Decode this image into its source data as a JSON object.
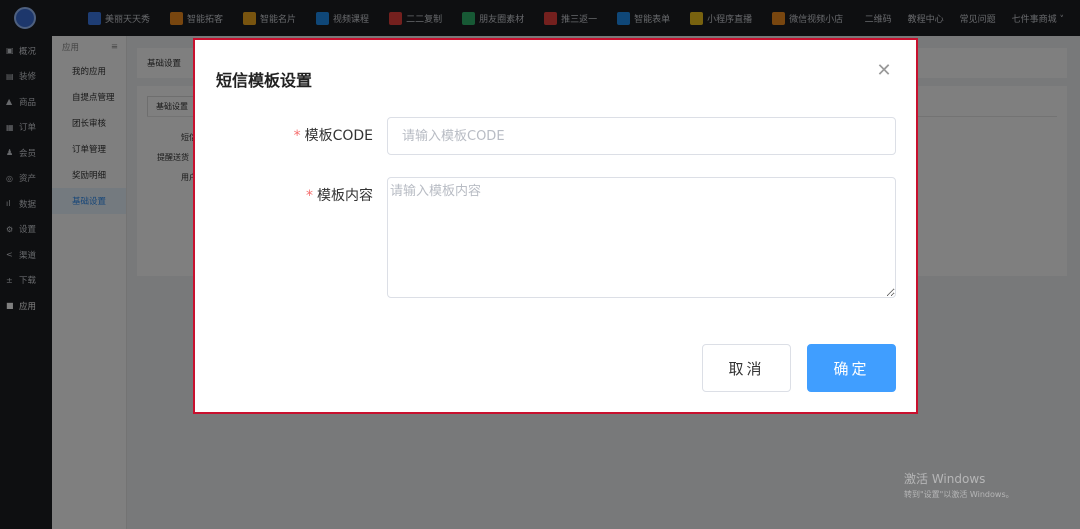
{
  "topbar": {
    "apps": [
      {
        "label": "美丽天天秀",
        "color": "#3c7be8"
      },
      {
        "label": "智能拓客",
        "color": "#f08c1f"
      },
      {
        "label": "智能名片",
        "color": "#f0a91f"
      },
      {
        "label": "视频课程",
        "color": "#1f8ff0"
      },
      {
        "label": "二二复制",
        "color": "#e8413c"
      },
      {
        "label": "朋友圈素材",
        "color": "#2fb36b"
      },
      {
        "label": "推三返一",
        "color": "#e8413c"
      },
      {
        "label": "智能表单",
        "color": "#1f8ff0"
      },
      {
        "label": "小程序直播",
        "color": "#f0c41f"
      },
      {
        "label": "微信视频小店",
        "color": "#f08c1f"
      }
    ],
    "right_links": [
      "二维码",
      "教程中心",
      "常见问题",
      "七件事商城 ˅"
    ]
  },
  "sidebar": {
    "items": [
      {
        "icon": "▣",
        "label": "概况"
      },
      {
        "icon": "▤",
        "label": "装修"
      },
      {
        "icon": "▲",
        "label": "商品"
      },
      {
        "icon": "▦",
        "label": "订单"
      },
      {
        "icon": "♟",
        "label": "会员"
      },
      {
        "icon": "◎",
        "label": "资产"
      },
      {
        "icon": "ıl",
        "label": "数据"
      },
      {
        "icon": "⚙",
        "label": "设置"
      },
      {
        "icon": "<",
        "label": "渠道"
      },
      {
        "icon": "±",
        "label": "下载"
      },
      {
        "icon": "■",
        "label": "应用"
      }
    ]
  },
  "subsidebar": {
    "header": "应用",
    "items": [
      "我的应用",
      "自提点管理",
      "团长审核",
      "订单管理",
      "奖励明细",
      "基础设置"
    ]
  },
  "main": {
    "breadcrumb": "基础设置",
    "tab": "基础设置",
    "col_label": "短信",
    "row1": "提醒送货",
    "row2": "用户"
  },
  "dialog": {
    "title": "短信模板设置",
    "close_glyph": "✕",
    "required_mark": "*",
    "code_label": "模板CODE",
    "code_placeholder": "请输入模板CODE",
    "content_label": "模板内容",
    "content_placeholder": "请输入模板内容",
    "cancel_label": "取消",
    "ok_label": "确定"
  },
  "watermark": {
    "line1": "激活 Windows",
    "line2": "转到\"设置\"以激活 Windows。"
  }
}
